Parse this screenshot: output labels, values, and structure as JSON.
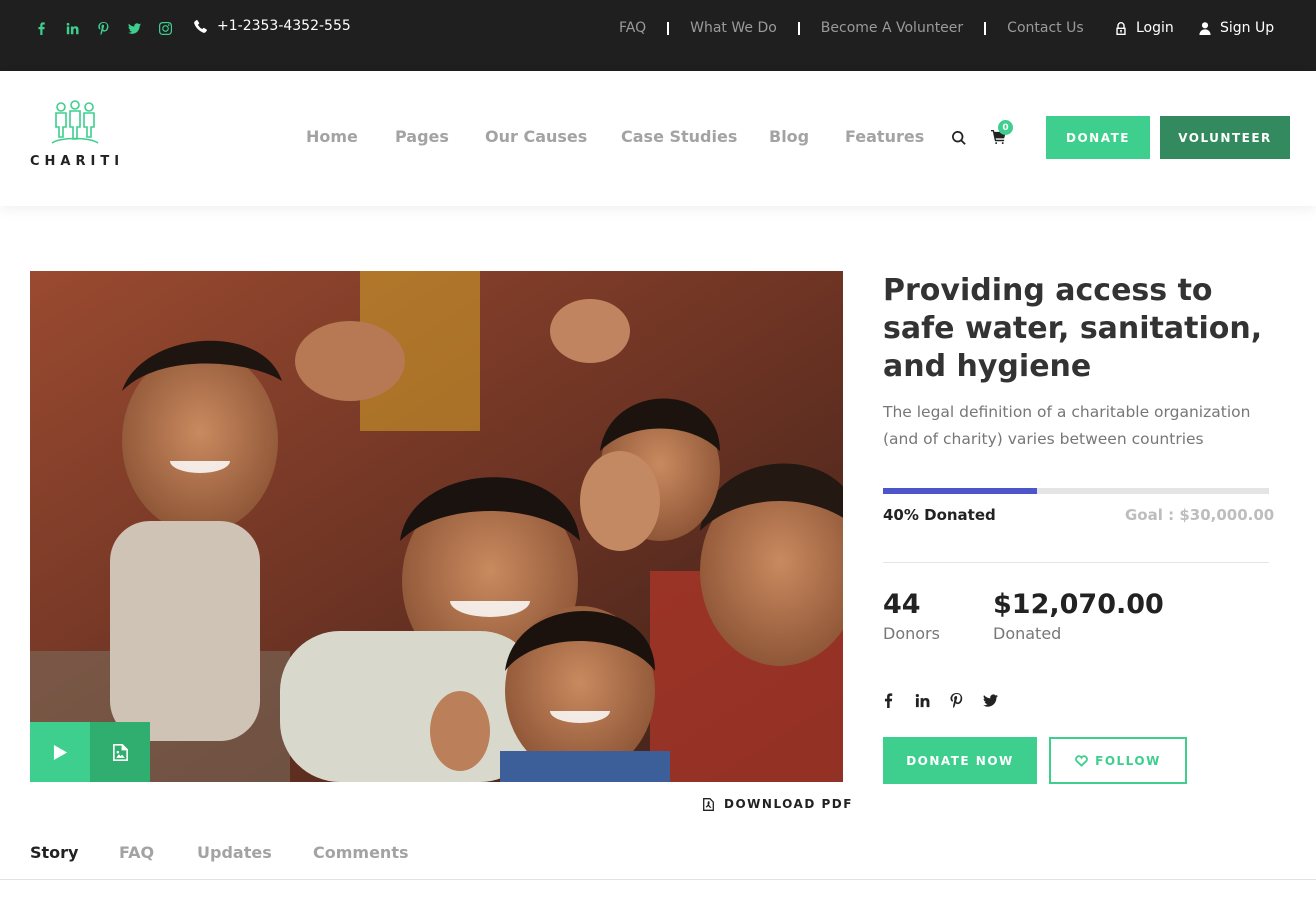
{
  "topbar": {
    "social_icons": [
      "facebook-icon",
      "linkedin-icon",
      "pinterest-icon",
      "twitter-icon",
      "instagram-icon"
    ],
    "phone": "+1-2353-4352-555",
    "links": [
      "FAQ",
      "What We Do",
      "Become A Volunteer",
      "Contact Us"
    ],
    "login_label": "Login",
    "signup_label": "Sign Up"
  },
  "header": {
    "logo_text": "CHARITI",
    "nav": [
      "Home",
      "Pages",
      "Our Causes",
      "Case Studies",
      "Blog",
      "Features"
    ],
    "cart_count": "0",
    "donate_label": "DONATE",
    "volunteer_label": "VOLUNTEER"
  },
  "media": {
    "download_label": "DOWNLOAD PDF"
  },
  "tabs": [
    "Story",
    "FAQ",
    "Updates",
    "Comments"
  ],
  "cause": {
    "title": "Providing access to safe water, sanitation, and hygiene",
    "description": "The legal definition of a charitable organization (and of charity) varies between countries",
    "progress_fraction": 0.4,
    "percent_label": "40% Donated",
    "goal_label": "Goal : $30,000.00",
    "donors_count": "44",
    "donors_label": "Donors",
    "donated_amount": "$12,070.00",
    "donated_label": "Donated",
    "share_icons": [
      "facebook-icon",
      "linkedin-icon",
      "pinterest-icon",
      "twitter-icon"
    ],
    "donate_now_label": "DONATE NOW",
    "follow_label": "FOLLOW"
  },
  "colors": {
    "accent": "#3ecf8e",
    "accent_dark": "#338a5e",
    "progress": "#4c55c9",
    "topbar_bg": "#1f1f1f"
  }
}
